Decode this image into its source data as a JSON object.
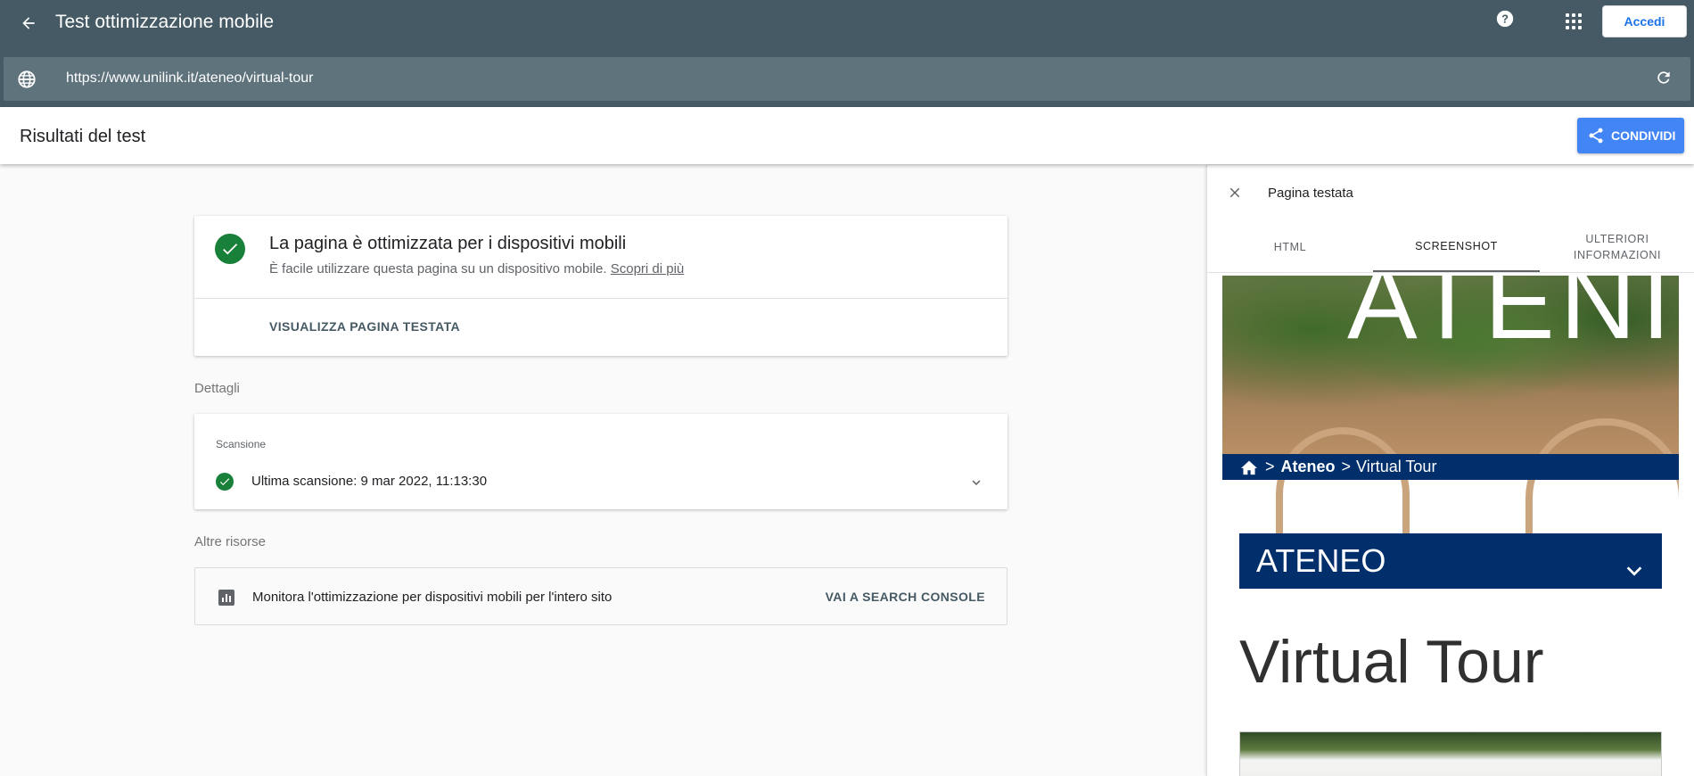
{
  "app": {
    "title": "Test ottimizzazione mobile",
    "signin_label": "Accedi",
    "url": "https://www.unilink.it/ateneo/virtual-tour"
  },
  "results": {
    "heading": "Risultati del test",
    "share_label": "CONDIVIDI"
  },
  "summary": {
    "title": "La pagina è ottimizzata per i dispositivi mobili",
    "description": "È facile utilizzare questa pagina su un dispositivo mobile.",
    "learn_more": "Scopri di più",
    "view_page": "VISUALIZZA PAGINA TESTATA"
  },
  "details": {
    "section_label": "Dettagli",
    "scan_label": "Scansione",
    "scan_text": "Ultima scansione: 9 mar 2022, 11:13:30"
  },
  "resources": {
    "section_label": "Altre risorse",
    "text": "Monitora l'ottimizzazione per dispositivi mobili per l'intero sito",
    "link": "VAI A SEARCH CONSOLE"
  },
  "panel": {
    "title": "Pagina testata",
    "tabs": [
      {
        "label": "HTML",
        "active": false
      },
      {
        "label": "SCREENSHOT",
        "active": true
      },
      {
        "label_line1": "ULTERIORI",
        "label_line2": "INFORMAZIONI",
        "active": false
      }
    ],
    "screenshot": {
      "hero_word": "ATENI",
      "breadcrumb": {
        "sep1": ">",
        "section": "Ateneo",
        "sep2": ">",
        "page": "Virtual Tour"
      },
      "dropdown_label": "ATENEO",
      "page_title": "Virtual Tour"
    }
  },
  "colors": {
    "topbar": "#455a64",
    "urlbar": "#5f737d",
    "success": "#188038",
    "share": "#4285f4",
    "site_navy": "#002f6c"
  },
  "icons": [
    "back-arrow-icon",
    "help-icon",
    "apps-grid-icon",
    "globe-icon",
    "refresh-icon",
    "share-icon",
    "check-circle-icon",
    "chevron-down-icon",
    "bar-chart-icon",
    "close-icon",
    "home-icon"
  ]
}
